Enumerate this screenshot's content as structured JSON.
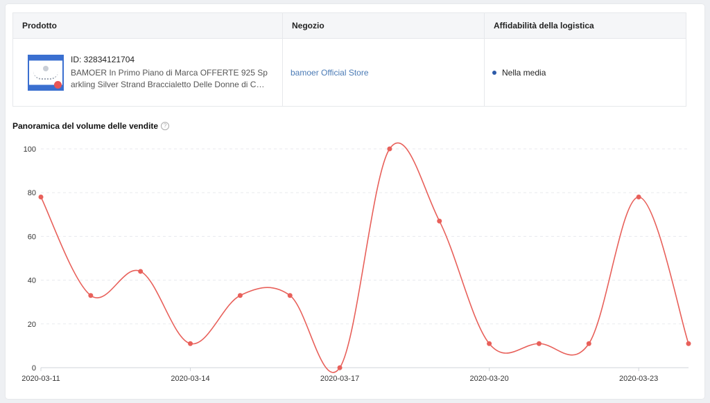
{
  "table": {
    "headers": {
      "product": "Prodotto",
      "store": "Negozio",
      "logistics": "Affidabilità della logistica"
    },
    "row": {
      "product_id": "ID: 32834121704",
      "product_name": "BAMOER In Primo Piano di Marca OFFERTE 925 Sparkling Silver Strand Braccialetto Delle Donne di Collegamento",
      "store_name": "bamoer Official Store",
      "logistics_status": "Nella media",
      "logistics_dot_color": "#2d5aa8"
    }
  },
  "chart_section": {
    "title": "Panoramica del volume delle vendite",
    "help_icon": "question-circle-icon"
  },
  "chart_data": {
    "type": "line",
    "x": [
      "2020-03-11",
      "2020-03-12",
      "2020-03-13",
      "2020-03-14",
      "2020-03-15",
      "2020-03-16",
      "2020-03-17",
      "2020-03-18",
      "2020-03-19",
      "2020-03-20",
      "2020-03-21",
      "2020-03-22",
      "2020-03-23",
      "2020-03-24"
    ],
    "x_tick_labels": [
      "2020-03-11",
      "2020-03-14",
      "2020-03-17",
      "2020-03-20",
      "2020-03-23"
    ],
    "y_ticks": [
      0,
      20,
      40,
      60,
      80,
      100
    ],
    "ylim": [
      0,
      100
    ],
    "series": [
      {
        "values": [
          78,
          33,
          44,
          11,
          33,
          33,
          0,
          100,
          67,
          11,
          11,
          11,
          78,
          11
        ],
        "color": "#e8605a"
      }
    ],
    "grid": "horizontal-dashed",
    "smooth": true
  }
}
